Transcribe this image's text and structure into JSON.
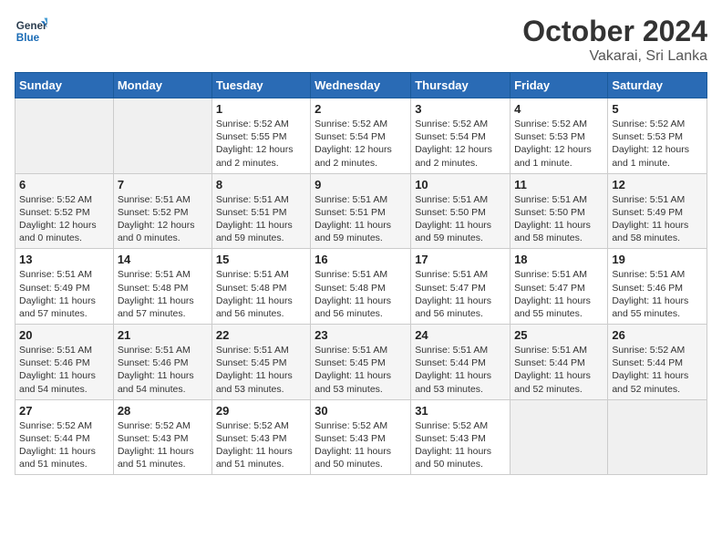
{
  "header": {
    "logo_line1": "General",
    "logo_line2": "Blue",
    "month": "October 2024",
    "location": "Vakarai, Sri Lanka"
  },
  "weekdays": [
    "Sunday",
    "Monday",
    "Tuesday",
    "Wednesday",
    "Thursday",
    "Friday",
    "Saturday"
  ],
  "weeks": [
    [
      {
        "day": "",
        "info": ""
      },
      {
        "day": "",
        "info": ""
      },
      {
        "day": "1",
        "info": "Sunrise: 5:52 AM\nSunset: 5:55 PM\nDaylight: 12 hours\nand 2 minutes."
      },
      {
        "day": "2",
        "info": "Sunrise: 5:52 AM\nSunset: 5:54 PM\nDaylight: 12 hours\nand 2 minutes."
      },
      {
        "day": "3",
        "info": "Sunrise: 5:52 AM\nSunset: 5:54 PM\nDaylight: 12 hours\nand 2 minutes."
      },
      {
        "day": "4",
        "info": "Sunrise: 5:52 AM\nSunset: 5:53 PM\nDaylight: 12 hours\nand 1 minute."
      },
      {
        "day": "5",
        "info": "Sunrise: 5:52 AM\nSunset: 5:53 PM\nDaylight: 12 hours\nand 1 minute."
      }
    ],
    [
      {
        "day": "6",
        "info": "Sunrise: 5:52 AM\nSunset: 5:52 PM\nDaylight: 12 hours\nand 0 minutes."
      },
      {
        "day": "7",
        "info": "Sunrise: 5:51 AM\nSunset: 5:52 PM\nDaylight: 12 hours\nand 0 minutes."
      },
      {
        "day": "8",
        "info": "Sunrise: 5:51 AM\nSunset: 5:51 PM\nDaylight: 11 hours\nand 59 minutes."
      },
      {
        "day": "9",
        "info": "Sunrise: 5:51 AM\nSunset: 5:51 PM\nDaylight: 11 hours\nand 59 minutes."
      },
      {
        "day": "10",
        "info": "Sunrise: 5:51 AM\nSunset: 5:50 PM\nDaylight: 11 hours\nand 59 minutes."
      },
      {
        "day": "11",
        "info": "Sunrise: 5:51 AM\nSunset: 5:50 PM\nDaylight: 11 hours\nand 58 minutes."
      },
      {
        "day": "12",
        "info": "Sunrise: 5:51 AM\nSunset: 5:49 PM\nDaylight: 11 hours\nand 58 minutes."
      }
    ],
    [
      {
        "day": "13",
        "info": "Sunrise: 5:51 AM\nSunset: 5:49 PM\nDaylight: 11 hours\nand 57 minutes."
      },
      {
        "day": "14",
        "info": "Sunrise: 5:51 AM\nSunset: 5:48 PM\nDaylight: 11 hours\nand 57 minutes."
      },
      {
        "day": "15",
        "info": "Sunrise: 5:51 AM\nSunset: 5:48 PM\nDaylight: 11 hours\nand 56 minutes."
      },
      {
        "day": "16",
        "info": "Sunrise: 5:51 AM\nSunset: 5:48 PM\nDaylight: 11 hours\nand 56 minutes."
      },
      {
        "day": "17",
        "info": "Sunrise: 5:51 AM\nSunset: 5:47 PM\nDaylight: 11 hours\nand 56 minutes."
      },
      {
        "day": "18",
        "info": "Sunrise: 5:51 AM\nSunset: 5:47 PM\nDaylight: 11 hours\nand 55 minutes."
      },
      {
        "day": "19",
        "info": "Sunrise: 5:51 AM\nSunset: 5:46 PM\nDaylight: 11 hours\nand 55 minutes."
      }
    ],
    [
      {
        "day": "20",
        "info": "Sunrise: 5:51 AM\nSunset: 5:46 PM\nDaylight: 11 hours\nand 54 minutes."
      },
      {
        "day": "21",
        "info": "Sunrise: 5:51 AM\nSunset: 5:46 PM\nDaylight: 11 hours\nand 54 minutes."
      },
      {
        "day": "22",
        "info": "Sunrise: 5:51 AM\nSunset: 5:45 PM\nDaylight: 11 hours\nand 53 minutes."
      },
      {
        "day": "23",
        "info": "Sunrise: 5:51 AM\nSunset: 5:45 PM\nDaylight: 11 hours\nand 53 minutes."
      },
      {
        "day": "24",
        "info": "Sunrise: 5:51 AM\nSunset: 5:44 PM\nDaylight: 11 hours\nand 53 minutes."
      },
      {
        "day": "25",
        "info": "Sunrise: 5:51 AM\nSunset: 5:44 PM\nDaylight: 11 hours\nand 52 minutes."
      },
      {
        "day": "26",
        "info": "Sunrise: 5:52 AM\nSunset: 5:44 PM\nDaylight: 11 hours\nand 52 minutes."
      }
    ],
    [
      {
        "day": "27",
        "info": "Sunrise: 5:52 AM\nSunset: 5:44 PM\nDaylight: 11 hours\nand 51 minutes."
      },
      {
        "day": "28",
        "info": "Sunrise: 5:52 AM\nSunset: 5:43 PM\nDaylight: 11 hours\nand 51 minutes."
      },
      {
        "day": "29",
        "info": "Sunrise: 5:52 AM\nSunset: 5:43 PM\nDaylight: 11 hours\nand 51 minutes."
      },
      {
        "day": "30",
        "info": "Sunrise: 5:52 AM\nSunset: 5:43 PM\nDaylight: 11 hours\nand 50 minutes."
      },
      {
        "day": "31",
        "info": "Sunrise: 5:52 AM\nSunset: 5:43 PM\nDaylight: 11 hours\nand 50 minutes."
      },
      {
        "day": "",
        "info": ""
      },
      {
        "day": "",
        "info": ""
      }
    ]
  ]
}
